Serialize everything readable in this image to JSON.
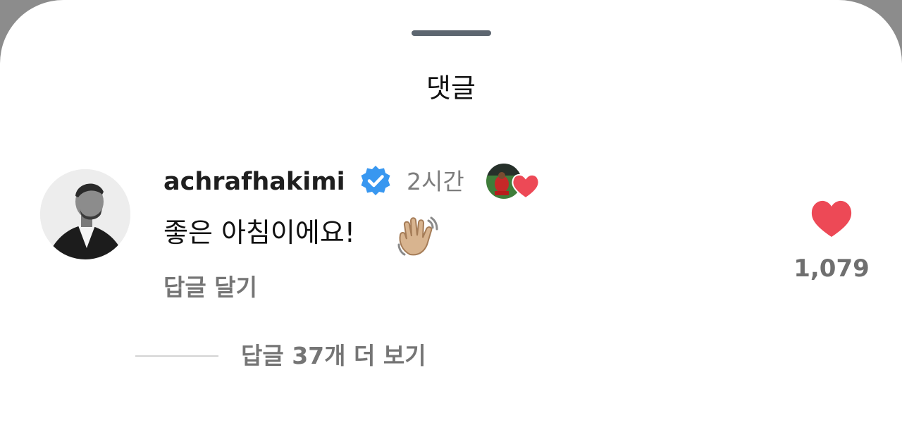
{
  "sheet": {
    "title": "댓글"
  },
  "comment": {
    "avatar_icon": "profile-photo",
    "username": "achrafhakimi",
    "verified_icon": "verified-badge-icon",
    "verified_color": "#3897f0",
    "timestamp": "2시간",
    "creator_like_icon": "creator-liked-heart-icon",
    "text": "좋은 아침이에요!",
    "emoji_icon": "waving-hand-emoji",
    "reply_label": "답글 달기",
    "like_icon": "heart-icon",
    "like_color": "#ed4956",
    "like_count": "1,079"
  },
  "replies": {
    "view_more_label": "답글 37개 더 보기"
  }
}
